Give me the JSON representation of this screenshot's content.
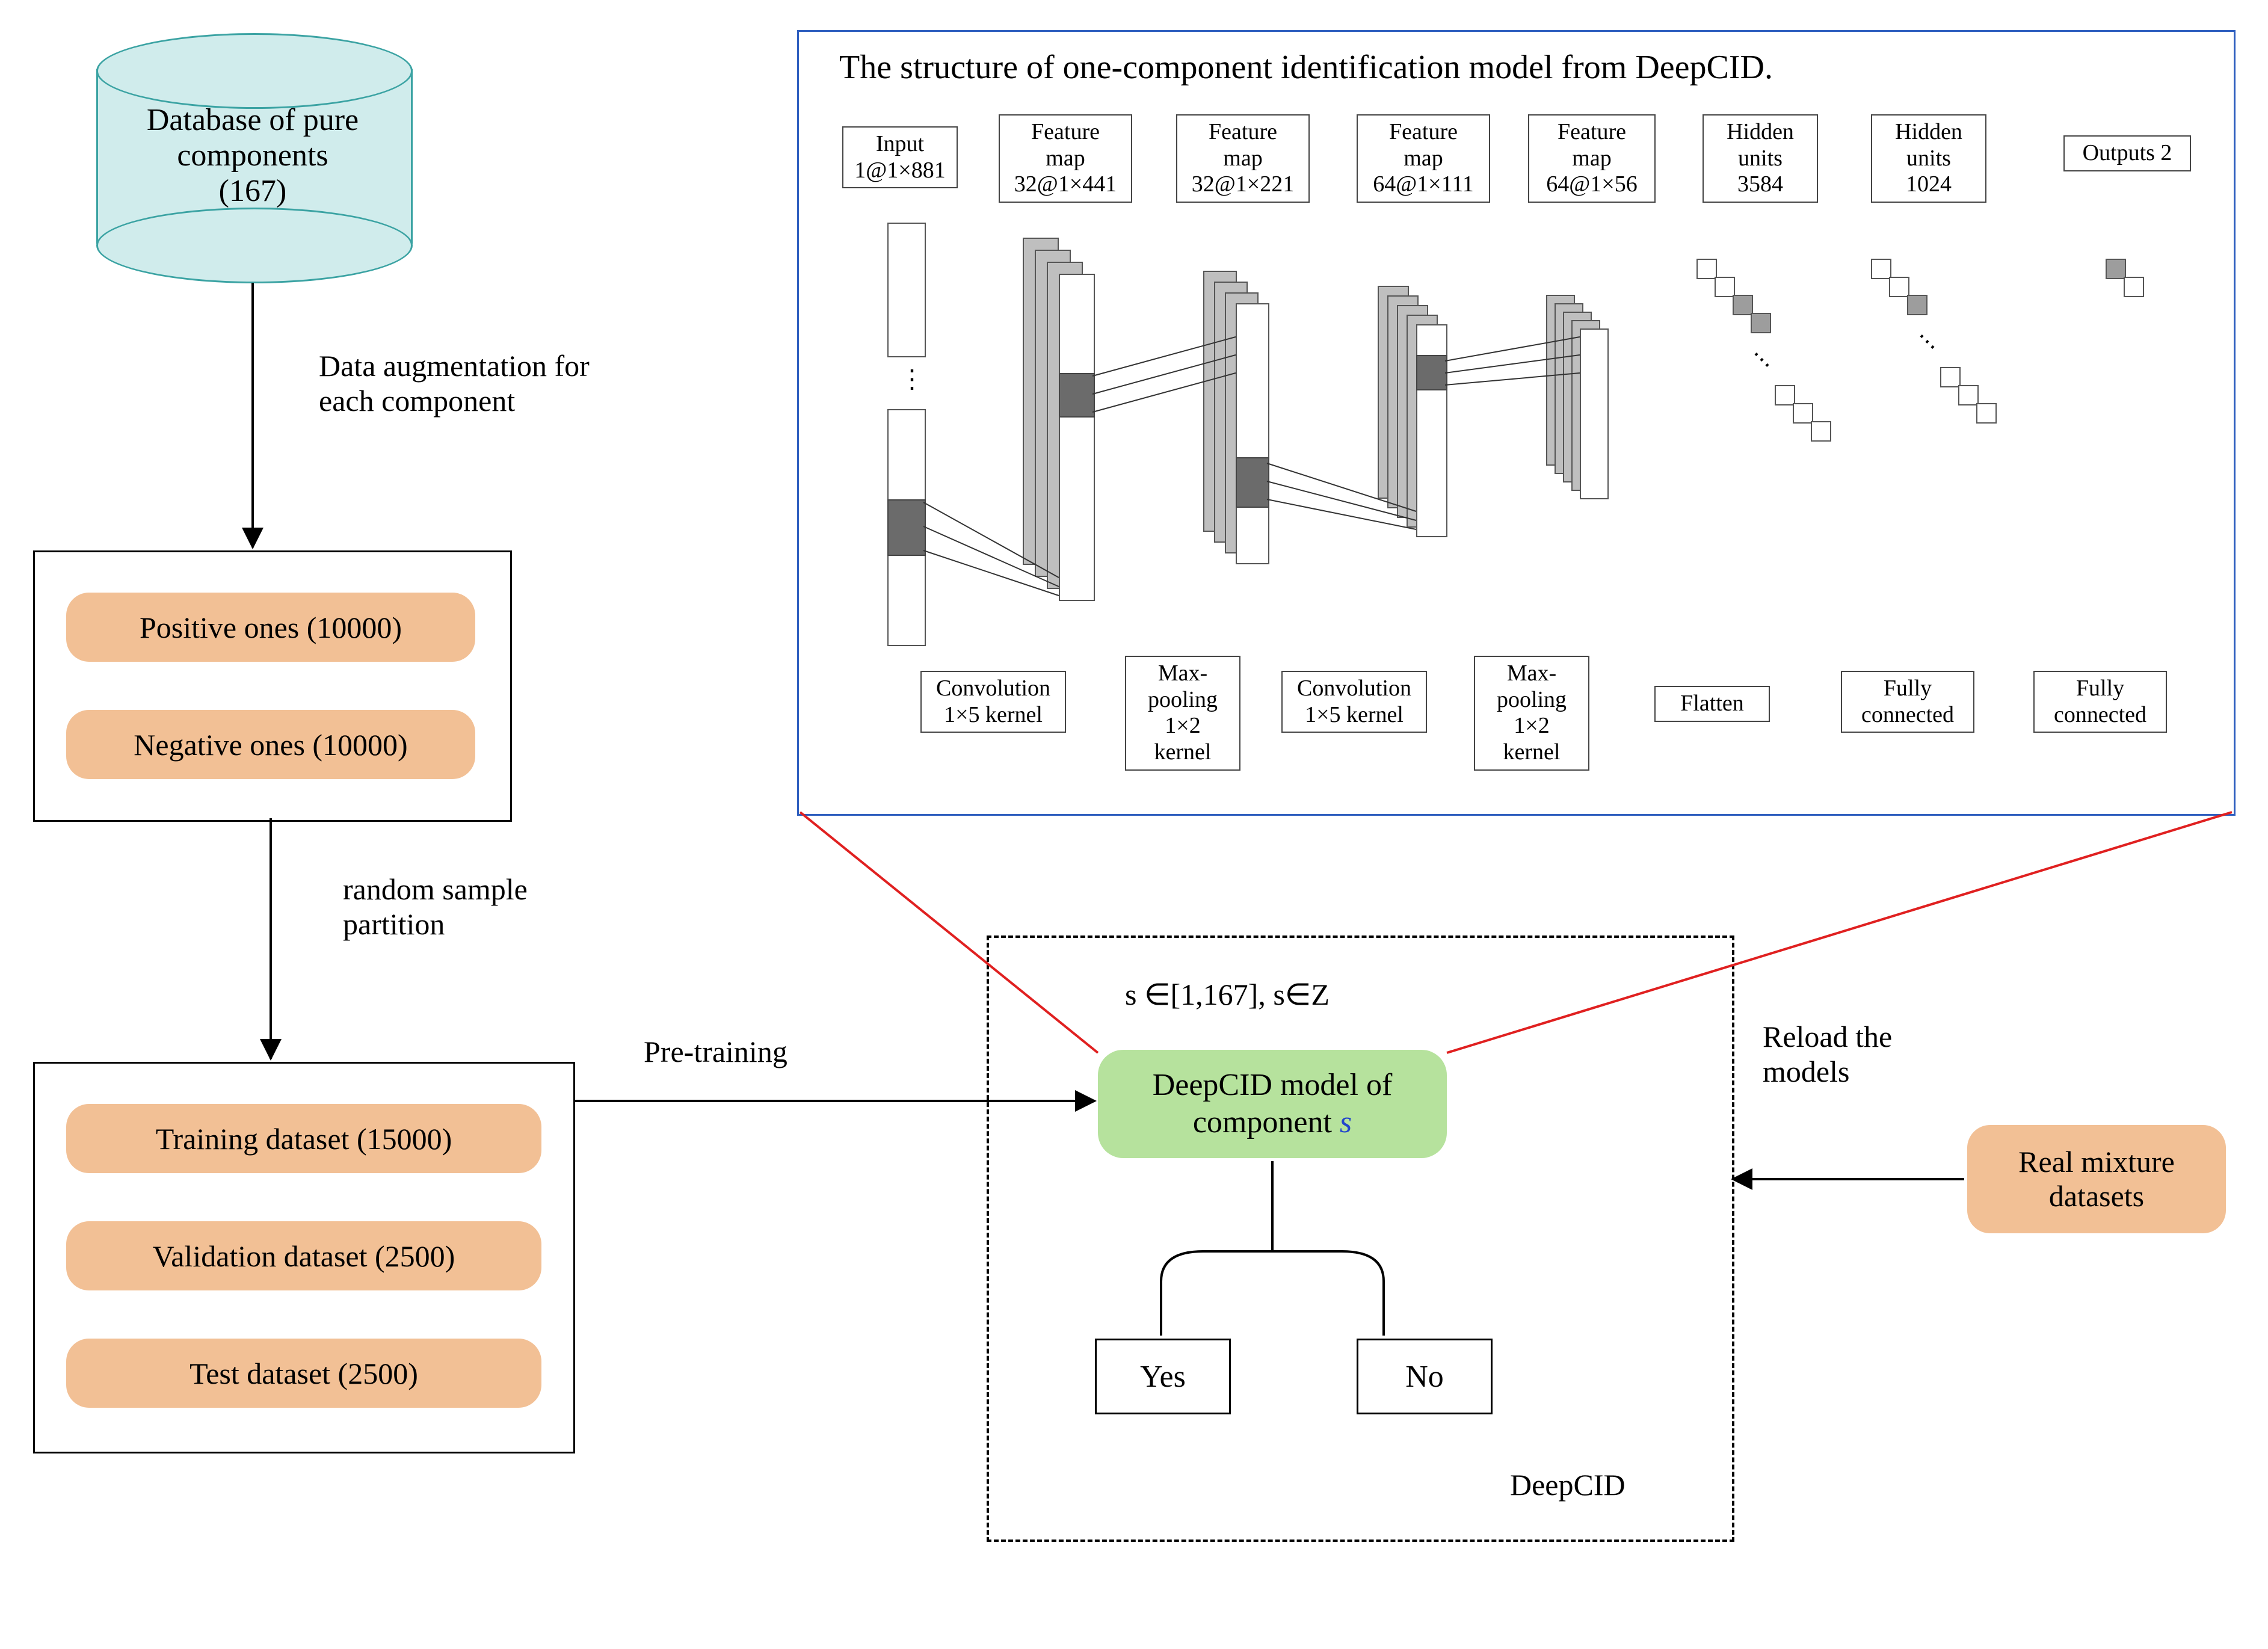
{
  "diagram": {
    "database": {
      "title_line1": "Database of pure",
      "title_line2": "components",
      "count": "(167)"
    },
    "augmentation_label_line1": "Data augmentation for",
    "augmentation_label_line2": "each component",
    "augmented_box": {
      "positive": "Positive ones (10000)",
      "negative": "Negative ones (10000)"
    },
    "partition_label_line1": "random sample",
    "partition_label_line2": "partition",
    "datasets_box": {
      "training": "Training dataset (15000)",
      "validation": "Validation dataset (2500)",
      "test": "Test dataset (2500)"
    },
    "pretraining_label": "Pre-training",
    "reload_label_line1": "Reload the",
    "reload_label_line2": "models",
    "deepcid_box": {
      "constraint": "s ∈[1,167], s∈Z",
      "model_line1": "DeepCID model of",
      "model_line2_prefix": "component ",
      "model_line2_var": "s",
      "yes": "Yes",
      "no": "No",
      "label": "DeepCID"
    },
    "real_mixture": "Real mixture\ndatasets"
  },
  "cnn_inset": {
    "title": "The structure of one-component identification model from DeepCID.",
    "top_layers": [
      {
        "l1": "Input",
        "l2": "1@1×881"
      },
      {
        "l1": "Feature",
        "l2": "map",
        "l3": "32@1×441"
      },
      {
        "l1": "Feature",
        "l2": "map",
        "l3": "32@1×221"
      },
      {
        "l1": "Feature",
        "l2": "map",
        "l3": "64@1×111"
      },
      {
        "l1": "Feature",
        "l2": "map",
        "l3": "64@1×56"
      },
      {
        "l1": "Hidden",
        "l2": "units",
        "l3": "3584"
      },
      {
        "l1": "Hidden",
        "l2": "units",
        "l3": "1024"
      },
      {
        "l1": "Outputs 2"
      }
    ],
    "bottom_ops": [
      {
        "l1": "Convolution",
        "l2": "1×5 kernel"
      },
      {
        "l1": "Max-",
        "l2": "pooling",
        "l3": "1×2",
        "l4": "kernel"
      },
      {
        "l1": "Convolution",
        "l2": "1×5 kernel"
      },
      {
        "l1": "Max-",
        "l2": "pooling",
        "l3": "1×2",
        "l4": "kernel"
      },
      {
        "l1": "Flatten"
      },
      {
        "l1": "Fully",
        "l2": "connected"
      },
      {
        "l1": "Fully",
        "l2": "connected"
      }
    ]
  },
  "chart_data": {
    "type": "diagram",
    "note": "Flow/architecture diagram, no numeric chart data beyond labeled counts already captured."
  }
}
